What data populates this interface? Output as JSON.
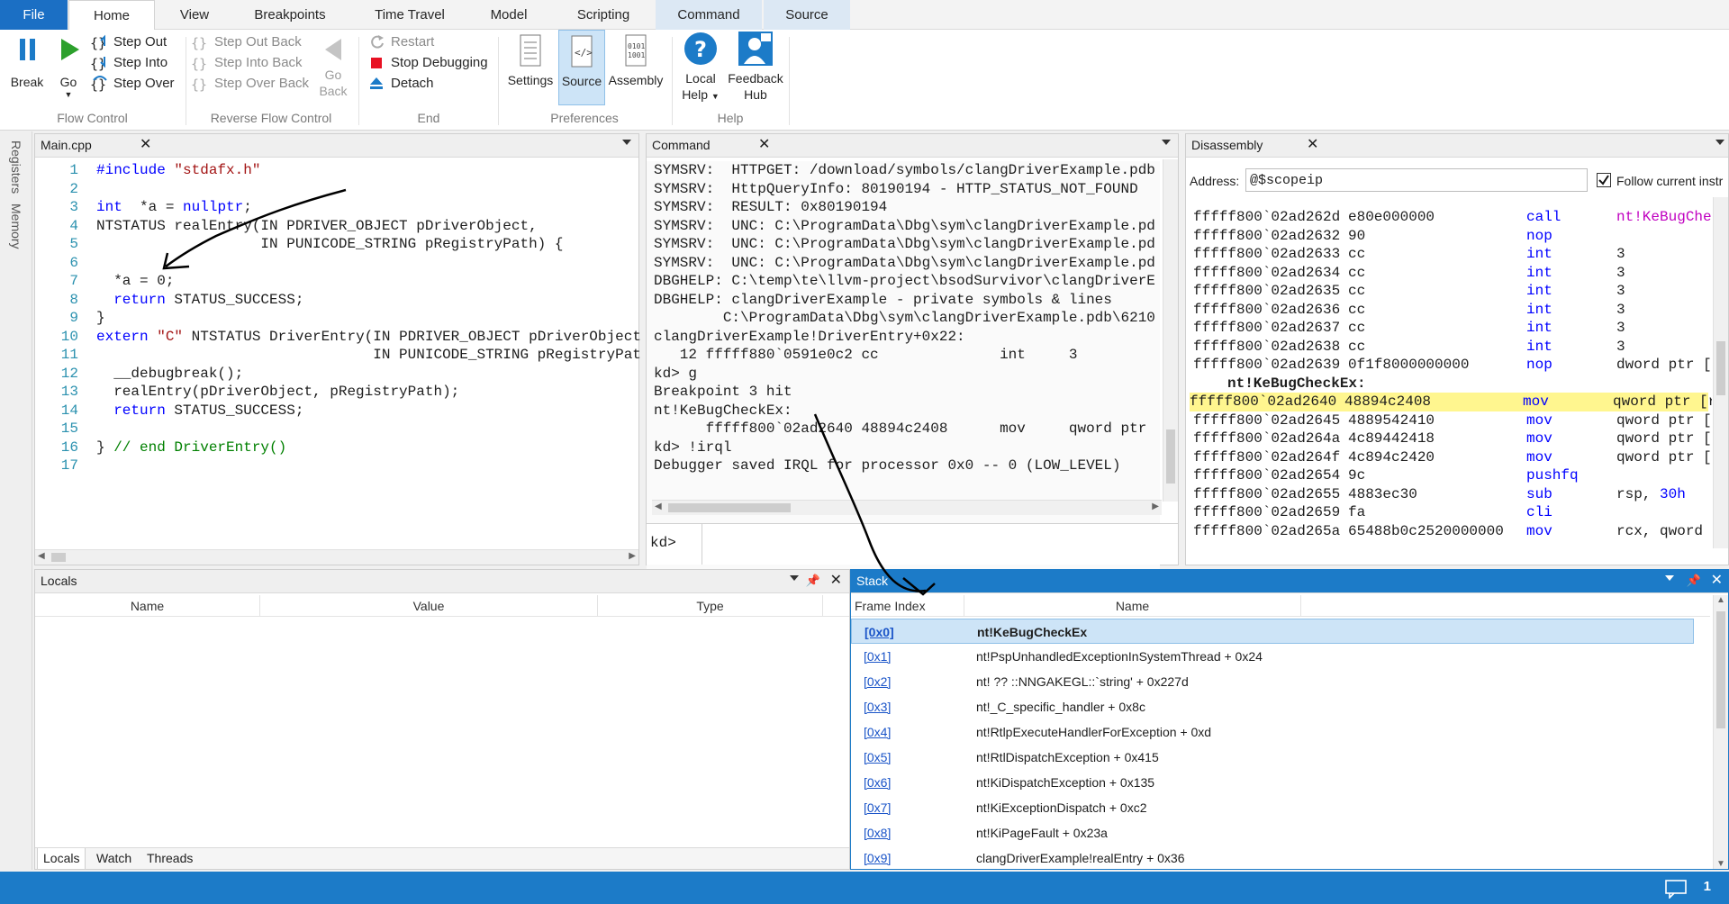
{
  "ribbon_tabs": {
    "file": "File",
    "home": "Home",
    "view": "View",
    "breakpoints": "Breakpoints",
    "time_travel": "Time Travel",
    "model": "Model",
    "scripting": "Scripting",
    "command": "Command",
    "source": "Source"
  },
  "flow_control": {
    "break": "Break",
    "go": "Go",
    "step_out": "Step Out",
    "step_into": "Step Into",
    "step_over": "Step Over",
    "label": "Flow Control"
  },
  "reverse_flow": {
    "step_out_back": "Step Out Back",
    "step_into_back": "Step Into Back",
    "step_over_back": "Step Over Back",
    "go_back": "Go",
    "go_back2": "Back",
    "label": "Reverse Flow Control"
  },
  "end_group": {
    "restart": "Restart",
    "stop": "Stop Debugging",
    "detach": "Detach",
    "label": "End"
  },
  "preferences": {
    "settings": "Settings",
    "source": "Source",
    "assembly": "Assembly",
    "label": "Preferences"
  },
  "help": {
    "local": "Local",
    "local2": "Help",
    "feedback": "Feedback",
    "feedback2": "Hub",
    "label": "Help"
  },
  "side": {
    "registers": "Registers",
    "memory": "Memory"
  },
  "source_panel": {
    "title": "Main.cpp",
    "lines": [
      {
        "n": "1",
        "parts": [
          [
            "kw",
            "#include "
          ],
          [
            "str",
            "\"stdafx.h\""
          ]
        ]
      },
      {
        "n": "2",
        "parts": []
      },
      {
        "n": "3",
        "parts": [
          [
            "kw",
            "int"
          ],
          [
            "",
            "  *a = "
          ],
          [
            "kw",
            "nullptr"
          ],
          [
            "",
            ";"
          ]
        ]
      },
      {
        "n": "4",
        "parts": [
          [
            "",
            "NTSTATUS realEntry(IN PDRIVER_OBJECT pDriverObject,"
          ]
        ]
      },
      {
        "n": "5",
        "parts": [
          [
            "",
            "                   IN PUNICODE_STRING pRegistryPath) {"
          ]
        ]
      },
      {
        "n": "6",
        "parts": []
      },
      {
        "n": "7",
        "parts": [
          [
            "",
            "  *a = 0;"
          ]
        ]
      },
      {
        "n": "8",
        "parts": [
          [
            "",
            "  "
          ],
          [
            "kw",
            "return"
          ],
          [
            "",
            " STATUS_SUCCESS;"
          ]
        ]
      },
      {
        "n": "9",
        "parts": [
          [
            "",
            "}"
          ]
        ]
      },
      {
        "n": "10",
        "parts": [
          [
            "kw",
            "extern"
          ],
          [
            "",
            " "
          ],
          [
            "str",
            "\"C\""
          ],
          [
            "",
            " NTSTATUS DriverEntry(IN PDRIVER_OBJECT pDriverObject"
          ]
        ]
      },
      {
        "n": "11",
        "parts": [
          [
            "",
            "                                IN PUNICODE_STRING pRegistryPat"
          ]
        ]
      },
      {
        "n": "12",
        "parts": [
          [
            "",
            "  __debugbreak();"
          ]
        ]
      },
      {
        "n": "13",
        "parts": [
          [
            "",
            "  realEntry(pDriverObject, pRegistryPath);"
          ]
        ]
      },
      {
        "n": "14",
        "parts": [
          [
            "",
            "  "
          ],
          [
            "kw",
            "return"
          ],
          [
            "",
            " STATUS_SUCCESS;"
          ]
        ]
      },
      {
        "n": "15",
        "parts": []
      },
      {
        "n": "16",
        "parts": [
          [
            "",
            "} "
          ],
          [
            "cm",
            "// end DriverEntry()"
          ]
        ]
      },
      {
        "n": "17",
        "parts": []
      }
    ]
  },
  "command_panel": {
    "title": "Command",
    "lines": [
      "SYMSRV:  HTTPGET: /download/symbols/clangDriverExample.pdb",
      "SYMSRV:  HttpQueryInfo: 80190194 - HTTP_STATUS_NOT_FOUND",
      "SYMSRV:  RESULT: 0x80190194",
      "SYMSRV:  UNC: C:\\ProgramData\\Dbg\\sym\\clangDriverExample.pd",
      "SYMSRV:  UNC: C:\\ProgramData\\Dbg\\sym\\clangDriverExample.pd",
      "SYMSRV:  UNC: C:\\ProgramData\\Dbg\\sym\\clangDriverExample.pd",
      "DBGHELP: C:\\temp\\te\\llvm-project\\bsodSurvivor\\clangDriverE",
      "DBGHELP: clangDriverExample - private symbols & lines",
      "        C:\\ProgramData\\Dbg\\sym\\clangDriverExample.pdb\\6210",
      "clangDriverExample!DriverEntry+0x22:",
      "   12 fffff880`0591e0c2 cc              int     3",
      "kd> g",
      "Breakpoint 3 hit",
      "nt!KeBugCheckEx:",
      "      fffff800`02ad2640 48894c2408      mov     qword ptr",
      "kd> !irql",
      "Debugger saved IRQL for processor 0x0 -- 0 (LOW_LEVEL)"
    ],
    "prompt": "kd>"
  },
  "disasm_panel": {
    "title": "Disassembly",
    "address_label": "Address:",
    "address_value": "@$scopeip",
    "follow_label": "Follow current instr",
    "rows": [
      {
        "addr": "fffff800`02ad262d",
        "bytes": "e80e000000",
        "mn": "call",
        "op": "nt!KeBugCheck"
      },
      {
        "addr": "fffff800`02ad2632",
        "bytes": "90",
        "mn": "nop",
        "op": ""
      },
      {
        "addr": "fffff800`02ad2633",
        "bytes": "cc",
        "mn": "int",
        "op": "3"
      },
      {
        "addr": "fffff800`02ad2634",
        "bytes": "cc",
        "mn": "int",
        "op": "3"
      },
      {
        "addr": "fffff800`02ad2635",
        "bytes": "cc",
        "mn": "int",
        "op": "3"
      },
      {
        "addr": "fffff800`02ad2636",
        "bytes": "cc",
        "mn": "int",
        "op": "3"
      },
      {
        "addr": "fffff800`02ad2637",
        "bytes": "cc",
        "mn": "int",
        "op": "3"
      },
      {
        "addr": "fffff800`02ad2638",
        "bytes": "cc",
        "mn": "int",
        "op": "3"
      },
      {
        "addr": "fffff800`02ad2639",
        "bytes": "0f1f8000000000",
        "mn": "nop",
        "op": "dword ptr [ra"
      },
      {
        "label": "nt!KeBugCheckEx:"
      },
      {
        "addr": "fffff800`02ad2640",
        "bytes": "48894c2408",
        "mn": "mov",
        "op": "qword ptr [rs",
        "hl": true
      },
      {
        "addr": "fffff800`02ad2645",
        "bytes": "4889542410",
        "mn": "mov",
        "op": "qword ptr [rs"
      },
      {
        "addr": "fffff800`02ad264a",
        "bytes": "4c89442418",
        "mn": "mov",
        "op": "qword ptr [rs"
      },
      {
        "addr": "fffff800`02ad264f",
        "bytes": "4c894c2420",
        "mn": "mov",
        "op": "qword ptr [rs"
      },
      {
        "addr": "fffff800`02ad2654",
        "bytes": "9c",
        "mn": "pushfq",
        "op": ""
      },
      {
        "addr": "fffff800`02ad2655",
        "bytes": "4883ec30",
        "mn": "sub",
        "op": "rsp, 30h"
      },
      {
        "addr": "fffff800`02ad2659",
        "bytes": "fa",
        "mn": "cli",
        "op": ""
      },
      {
        "addr": "fffff800`02ad265a",
        "bytes": "65488b0c2520000000",
        "mn": "mov",
        "op": "rcx, qword pt"
      }
    ]
  },
  "locals_panel": {
    "title": "Locals",
    "columns": [
      "Name",
      "Value",
      "Type"
    ],
    "tabs": [
      "Locals",
      "Watch",
      "Threads"
    ]
  },
  "stack_panel": {
    "title": "Stack",
    "columns": [
      "Frame Index",
      "Name"
    ],
    "rows": [
      {
        "idx": "[0x0]",
        "name": "nt!KeBugCheckEx"
      },
      {
        "idx": "[0x1]",
        "name": "nt!PspUnhandledExceptionInSystemThread + 0x24"
      },
      {
        "idx": "[0x2]",
        "name": "nt! ?? ::NNGAKEGL::`string' + 0x227d"
      },
      {
        "idx": "[0x3]",
        "name": "nt!_C_specific_handler + 0x8c"
      },
      {
        "idx": "[0x4]",
        "name": "nt!RtlpExecuteHandlerForException + 0xd"
      },
      {
        "idx": "[0x5]",
        "name": "nt!RtlDispatchException + 0x415"
      },
      {
        "idx": "[0x6]",
        "name": "nt!KiDispatchException + 0x135"
      },
      {
        "idx": "[0x7]",
        "name": "nt!KiExceptionDispatch + 0xc2"
      },
      {
        "idx": "[0x8]",
        "name": "nt!KiPageFault + 0x23a"
      },
      {
        "idx": "[0x9]",
        "name": "clangDriverExample!realEntry + 0x36"
      }
    ]
  },
  "status": {
    "notifications": "1"
  },
  "colors": {
    "accent": "#1c7bc8",
    "file_tab": "#1b6fc4",
    "highlight": "#fff68f"
  }
}
